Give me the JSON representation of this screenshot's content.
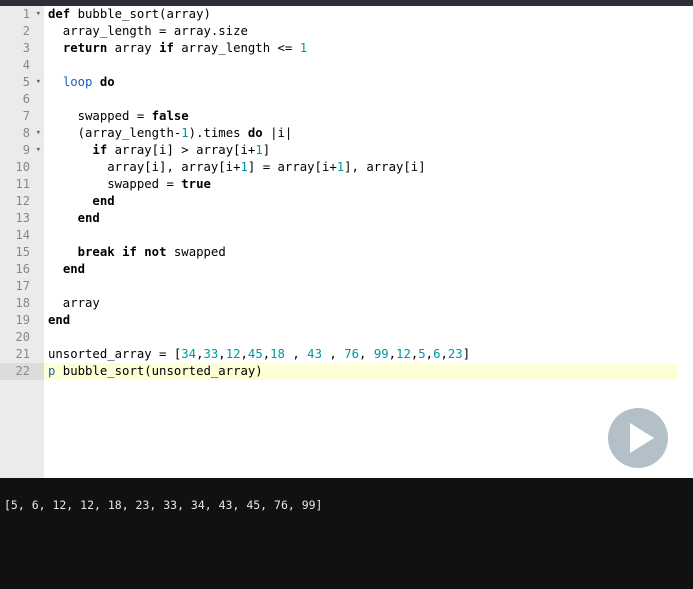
{
  "editor": {
    "lines": [
      {
        "n": "1",
        "fold": true,
        "tokens": [
          {
            "t": "def ",
            "c": "kw"
          },
          {
            "t": "bubble_sort(array)",
            "c": "plain"
          }
        ]
      },
      {
        "n": "2",
        "fold": false,
        "tokens": [
          {
            "t": "  array_length = array.size",
            "c": "plain"
          }
        ]
      },
      {
        "n": "3",
        "fold": false,
        "tokens": [
          {
            "t": "  ",
            "c": "plain"
          },
          {
            "t": "return",
            "c": "kw"
          },
          {
            "t": " array ",
            "c": "plain"
          },
          {
            "t": "if",
            "c": "kw"
          },
          {
            "t": " array_length <= ",
            "c": "plain"
          },
          {
            "t": "1",
            "c": "num"
          }
        ]
      },
      {
        "n": "4",
        "fold": false,
        "tokens": []
      },
      {
        "n": "5",
        "fold": true,
        "tokens": [
          {
            "t": "  ",
            "c": "plain"
          },
          {
            "t": "loop",
            "c": "kb"
          },
          {
            "t": " ",
            "c": "plain"
          },
          {
            "t": "do",
            "c": "kw"
          }
        ]
      },
      {
        "n": "6",
        "fold": false,
        "tokens": []
      },
      {
        "n": "7",
        "fold": false,
        "tokens": [
          {
            "t": "    swapped = ",
            "c": "plain"
          },
          {
            "t": "false",
            "c": "kw"
          }
        ]
      },
      {
        "n": "8",
        "fold": true,
        "tokens": [
          {
            "t": "    (array_length-",
            "c": "plain"
          },
          {
            "t": "1",
            "c": "num"
          },
          {
            "t": ").times ",
            "c": "plain"
          },
          {
            "t": "do",
            "c": "kw"
          },
          {
            "t": " |i|",
            "c": "plain"
          }
        ]
      },
      {
        "n": "9",
        "fold": true,
        "tokens": [
          {
            "t": "      ",
            "c": "plain"
          },
          {
            "t": "if",
            "c": "kw"
          },
          {
            "t": " array[i] > array[i+",
            "c": "plain"
          },
          {
            "t": "1",
            "c": "num"
          },
          {
            "t": "]",
            "c": "plain"
          }
        ]
      },
      {
        "n": "10",
        "fold": false,
        "tokens": [
          {
            "t": "        array[i], array[i+",
            "c": "plain"
          },
          {
            "t": "1",
            "c": "num"
          },
          {
            "t": "] = array[i+",
            "c": "plain"
          },
          {
            "t": "1",
            "c": "num"
          },
          {
            "t": "], array[i]",
            "c": "plain"
          }
        ]
      },
      {
        "n": "11",
        "fold": false,
        "tokens": [
          {
            "t": "        swapped = ",
            "c": "plain"
          },
          {
            "t": "true",
            "c": "kw"
          }
        ]
      },
      {
        "n": "12",
        "fold": false,
        "tokens": [
          {
            "t": "      ",
            "c": "plain"
          },
          {
            "t": "end",
            "c": "kw"
          }
        ]
      },
      {
        "n": "13",
        "fold": false,
        "tokens": [
          {
            "t": "    ",
            "c": "plain"
          },
          {
            "t": "end",
            "c": "kw"
          }
        ]
      },
      {
        "n": "14",
        "fold": false,
        "tokens": []
      },
      {
        "n": "15",
        "fold": false,
        "tokens": [
          {
            "t": "    ",
            "c": "plain"
          },
          {
            "t": "break",
            "c": "kw"
          },
          {
            "t": " ",
            "c": "plain"
          },
          {
            "t": "if",
            "c": "kw"
          },
          {
            "t": " ",
            "c": "plain"
          },
          {
            "t": "not",
            "c": "kw"
          },
          {
            "t": " swapped",
            "c": "plain"
          }
        ]
      },
      {
        "n": "16",
        "fold": false,
        "tokens": [
          {
            "t": "  ",
            "c": "plain"
          },
          {
            "t": "end",
            "c": "kw"
          }
        ]
      },
      {
        "n": "17",
        "fold": false,
        "tokens": []
      },
      {
        "n": "18",
        "fold": false,
        "tokens": [
          {
            "t": "  array",
            "c": "plain"
          }
        ]
      },
      {
        "n": "19",
        "fold": false,
        "tokens": [
          {
            "t": "end",
            "c": "kw"
          }
        ]
      },
      {
        "n": "20",
        "fold": false,
        "tokens": []
      },
      {
        "n": "21",
        "fold": false,
        "tokens": [
          {
            "t": "unsorted_array = [",
            "c": "plain"
          },
          {
            "t": "34",
            "c": "num"
          },
          {
            "t": ",",
            "c": "plain"
          },
          {
            "t": "33",
            "c": "num"
          },
          {
            "t": ",",
            "c": "plain"
          },
          {
            "t": "12",
            "c": "num"
          },
          {
            "t": ",",
            "c": "plain"
          },
          {
            "t": "45",
            "c": "num"
          },
          {
            "t": ",",
            "c": "plain"
          },
          {
            "t": "18",
            "c": "num"
          },
          {
            "t": " , ",
            "c": "plain"
          },
          {
            "t": "43",
            "c": "num"
          },
          {
            "t": " , ",
            "c": "plain"
          },
          {
            "t": "76",
            "c": "num"
          },
          {
            "t": ", ",
            "c": "plain"
          },
          {
            "t": "99",
            "c": "num"
          },
          {
            "t": ",",
            "c": "plain"
          },
          {
            "t": "12",
            "c": "num"
          },
          {
            "t": ",",
            "c": "plain"
          },
          {
            "t": "5",
            "c": "num"
          },
          {
            "t": ",",
            "c": "plain"
          },
          {
            "t": "6",
            "c": "num"
          },
          {
            "t": ",",
            "c": "plain"
          },
          {
            "t": "23",
            "c": "num"
          },
          {
            "t": "]",
            "c": "plain"
          }
        ]
      },
      {
        "n": "22",
        "fold": false,
        "active": true,
        "tokens": [
          {
            "t": "p",
            "c": "kb"
          },
          {
            "t": " bubble_sort(unsorted_array)",
            "c": "plain"
          }
        ]
      }
    ]
  },
  "run_button": {
    "icon": "play-icon"
  },
  "console": {
    "output": "[5, 6, 12, 12, 18, 23, 33, 34, 43, 45, 76, 99]"
  }
}
